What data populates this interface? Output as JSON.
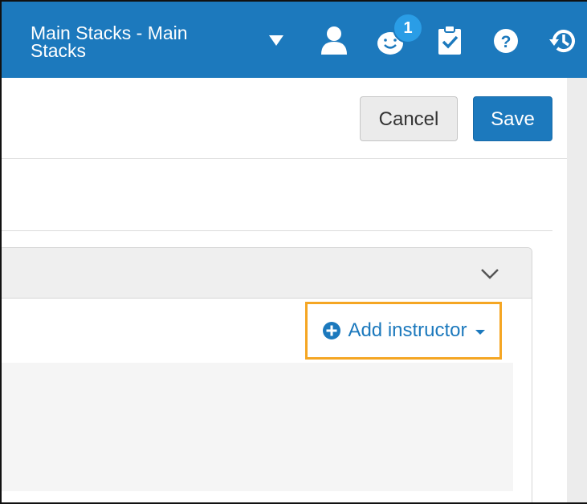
{
  "topbar": {
    "library_name": "Main Stacks - Main Stacks",
    "notification_count": "1",
    "icons": [
      "caret-down-icon",
      "user-icon",
      "notifications-icon",
      "tasks-clipboard-icon",
      "help-icon",
      "history-icon"
    ],
    "background_color": "#1c79bd"
  },
  "toolbar": {
    "cancel_label": "Cancel",
    "save_label": "Save"
  },
  "section": {
    "toggle_icon": "chevron-down-icon",
    "add_instructor_label": "Add instructor",
    "add_icon": "plus-circle-icon",
    "highlight_color": "#f5a623"
  }
}
